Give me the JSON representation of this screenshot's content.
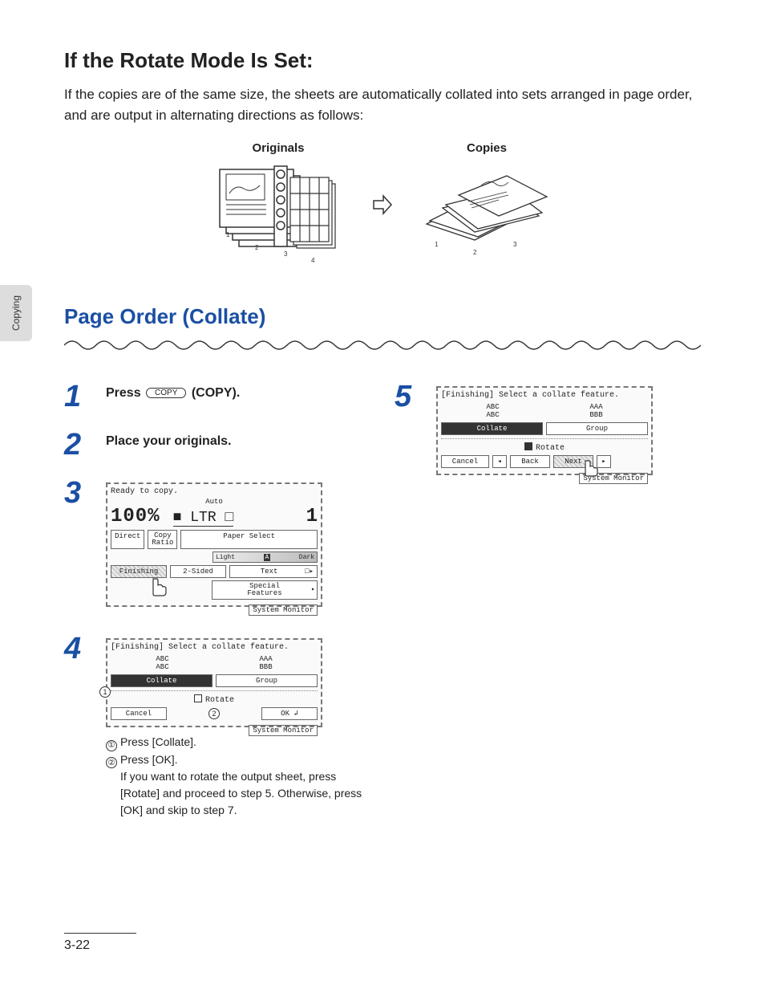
{
  "sideTab": "Copying",
  "section1": {
    "heading": "If the Rotate Mode Is Set:",
    "body": "If the copies are of the same size, the sheets are automatically collated into sets arranged in page order, and are output in alternating directions as follows:"
  },
  "illus": {
    "originalsLabel": "Originals",
    "copiesLabel": "Copies"
  },
  "section2Heading": "Page Order (Collate)",
  "steps": {
    "s1": {
      "num": "1",
      "text_a": "Press ",
      "key": "COPY",
      "text_b": " (COPY)."
    },
    "s2": {
      "num": "2",
      "text": "Place your originals."
    },
    "s3": {
      "num": "3"
    },
    "s4": {
      "num": "4"
    },
    "s5": {
      "num": "5"
    }
  },
  "lcd3": {
    "ready": "Ready to copy.",
    "auto": "Auto",
    "pct": "100%",
    "ltr": "LTR",
    "one": "1",
    "direct": "Direct",
    "copyRatio": "Copy\nRatio",
    "paperSelect": "Paper Select",
    "light": "Light",
    "dark": "Dark",
    "a": "A",
    "finishing": "Finishing",
    "twoSided": "2-Sided",
    "textMode": "Text",
    "special": "Special\nFeatures",
    "sysmon": "System Monitor"
  },
  "lcd4": {
    "title": "[Finishing] Select a collate feature.",
    "abc": "ABC",
    "aaa": "AAA",
    "bbb": "BBB",
    "collate": "Collate",
    "group": "Group",
    "rotate": "Rotate",
    "cancel": "Cancel",
    "ok": "OK",
    "sysmon": "System Monitor",
    "call1": "1",
    "call2": "2"
  },
  "lcd5": {
    "title": "[Finishing] Select a collate feature.",
    "abc": "ABC",
    "aaa": "AAA",
    "bbb": "BBB",
    "collate": "Collate",
    "group": "Group",
    "rotate": "Rotate",
    "cancel": "Cancel",
    "back": "Back",
    "next": "Next",
    "sysmon": "System Monitor"
  },
  "sub4": {
    "l1": "Press [Collate].",
    "l2": "Press [OK].",
    "l3": "If you want to rotate the output sheet, press [Rotate] and proceed to step 5. Otherwise, press [OK] and skip to step 7."
  },
  "pageNumber": "3-22"
}
